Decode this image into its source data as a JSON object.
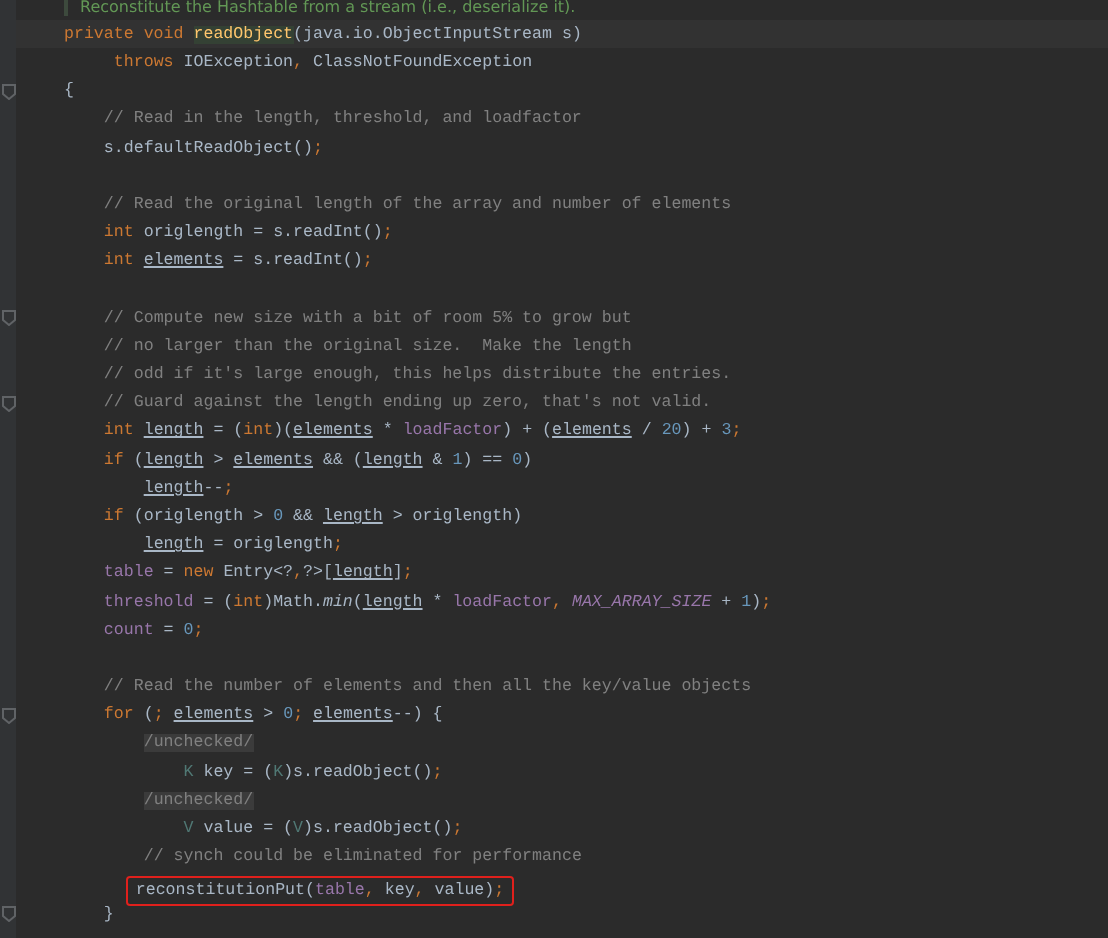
{
  "doc_comment": "Reconstitute the Hashtable from a stream (i.e., deserialize it).",
  "lines": [
    {
      "kind": "code",
      "current": true,
      "tokens": [
        {
          "t": "private void ",
          "kind": "kw"
        },
        {
          "t": "readObject",
          "kind": "decl"
        },
        {
          "t": "(java.io.ObjectInputStream s)",
          "kind": "plain"
        }
      ]
    },
    {
      "kind": "code",
      "tokens": [
        {
          "t": "     throws ",
          "kind": "kw"
        },
        {
          "t": "IOException",
          "kind": "plain"
        },
        {
          "t": ",",
          "kind": "kw"
        },
        {
          "t": " ClassNotFoundException",
          "kind": "plain"
        }
      ]
    },
    {
      "kind": "code",
      "fold": true,
      "tokens": [
        {
          "t": "{",
          "kind": "plain"
        }
      ]
    },
    {
      "kind": "code",
      "tokens": [
        {
          "t": "    // Read in the length, threshold, and loadfactor",
          "kind": "comment"
        }
      ]
    },
    {
      "kind": "code",
      "tokens": [
        {
          "t": "    s.defaultReadObject()",
          "kind": "plain"
        },
        {
          "t": ";",
          "kind": "kw"
        }
      ]
    },
    {
      "kind": "blank"
    },
    {
      "kind": "code",
      "tokens": [
        {
          "t": "    // Read the original length of the array and number of elements",
          "kind": "comment"
        }
      ]
    },
    {
      "kind": "code",
      "tokens": [
        {
          "t": "    int ",
          "kind": "kw"
        },
        {
          "t": "origlength = s.readInt()",
          "kind": "plain"
        },
        {
          "t": ";",
          "kind": "kw"
        }
      ]
    },
    {
      "kind": "code",
      "tokens": [
        {
          "t": "    int ",
          "kind": "kw"
        },
        {
          "t": "elements",
          "kind": "var"
        },
        {
          "t": " = s.readInt()",
          "kind": "plain"
        },
        {
          "t": ";",
          "kind": "kw"
        }
      ]
    },
    {
      "kind": "blank"
    },
    {
      "kind": "code",
      "fold": true,
      "tokens": [
        {
          "t": "    // Compute new size with a bit of room 5% to grow but",
          "kind": "comment"
        }
      ]
    },
    {
      "kind": "code",
      "tokens": [
        {
          "t": "    // no larger than the original size.  Make the length",
          "kind": "comment"
        }
      ]
    },
    {
      "kind": "code",
      "tokens": [
        {
          "t": "    // odd if it's large enough, this helps distribute the entries.",
          "kind": "comment"
        }
      ]
    },
    {
      "kind": "code",
      "fold": true,
      "tokens": [
        {
          "t": "    // Guard against the length ending up zero, that's not valid.",
          "kind": "comment"
        }
      ]
    },
    {
      "kind": "code",
      "tokens": [
        {
          "t": "    int ",
          "kind": "kw"
        },
        {
          "t": "length",
          "kind": "var"
        },
        {
          "t": " = (",
          "kind": "plain"
        },
        {
          "t": "int",
          "kind": "kw"
        },
        {
          "t": ")(",
          "kind": "plain"
        },
        {
          "t": "elements",
          "kind": "var"
        },
        {
          "t": " * ",
          "kind": "plain"
        },
        {
          "t": "loadFactor",
          "kind": "field"
        },
        {
          "t": ") + (",
          "kind": "plain"
        },
        {
          "t": "elements",
          "kind": "var"
        },
        {
          "t": " / ",
          "kind": "plain"
        },
        {
          "t": "20",
          "kind": "num"
        },
        {
          "t": ") + ",
          "kind": "plain"
        },
        {
          "t": "3",
          "kind": "num"
        },
        {
          "t": ";",
          "kind": "kw"
        }
      ]
    },
    {
      "kind": "code",
      "tokens": [
        {
          "t": "    if ",
          "kind": "kw"
        },
        {
          "t": "(",
          "kind": "plain"
        },
        {
          "t": "length",
          "kind": "var"
        },
        {
          "t": " > ",
          "kind": "plain"
        },
        {
          "t": "elements",
          "kind": "var"
        },
        {
          "t": " && (",
          "kind": "plain"
        },
        {
          "t": "length",
          "kind": "var"
        },
        {
          "t": " & ",
          "kind": "plain"
        },
        {
          "t": "1",
          "kind": "num"
        },
        {
          "t": ") == ",
          "kind": "plain"
        },
        {
          "t": "0",
          "kind": "num"
        },
        {
          "t": ")",
          "kind": "plain"
        }
      ]
    },
    {
      "kind": "code",
      "tokens": [
        {
          "t": "        length",
          "kind": "var"
        },
        {
          "t": "--",
          "kind": "plain"
        },
        {
          "t": ";",
          "kind": "kw"
        }
      ]
    },
    {
      "kind": "code",
      "tokens": [
        {
          "t": "    if ",
          "kind": "kw"
        },
        {
          "t": "(origlength > ",
          "kind": "plain"
        },
        {
          "t": "0",
          "kind": "num"
        },
        {
          "t": " && ",
          "kind": "plain"
        },
        {
          "t": "length",
          "kind": "var"
        },
        {
          "t": " > origlength)",
          "kind": "plain"
        }
      ]
    },
    {
      "kind": "code",
      "tokens": [
        {
          "t": "        length",
          "kind": "var"
        },
        {
          "t": " = origlength",
          "kind": "plain"
        },
        {
          "t": ";",
          "kind": "kw"
        }
      ]
    },
    {
      "kind": "code",
      "tokens": [
        {
          "t": "    table",
          "kind": "field"
        },
        {
          "t": " = ",
          "kind": "plain"
        },
        {
          "t": "new ",
          "kind": "kw"
        },
        {
          "t": "Entry<?",
          "kind": "plain"
        },
        {
          "t": ",",
          "kind": "kw"
        },
        {
          "t": "?>[",
          "kind": "plain"
        },
        {
          "t": "length",
          "kind": "var"
        },
        {
          "t": "]",
          "kind": "plain"
        },
        {
          "t": ";",
          "kind": "kw"
        }
      ]
    },
    {
      "kind": "code",
      "tokens": [
        {
          "t": "    threshold",
          "kind": "field"
        },
        {
          "t": " = (",
          "kind": "plain"
        },
        {
          "t": "int",
          "kind": "kw"
        },
        {
          "t": ")Math.",
          "kind": "plain"
        },
        {
          "t": "min",
          "kind": "static"
        },
        {
          "t": "(",
          "kind": "plain"
        },
        {
          "t": "length",
          "kind": "var"
        },
        {
          "t": " * ",
          "kind": "plain"
        },
        {
          "t": "loadFactor",
          "kind": "field"
        },
        {
          "t": ", ",
          "kind": "kw"
        },
        {
          "t": "MAX_ARRAY_SIZE",
          "kind": "const"
        },
        {
          "t": " + ",
          "kind": "plain"
        },
        {
          "t": "1",
          "kind": "num"
        },
        {
          "t": ")",
          "kind": "plain"
        },
        {
          "t": ";",
          "kind": "kw"
        }
      ]
    },
    {
      "kind": "code",
      "tokens": [
        {
          "t": "    count",
          "kind": "field"
        },
        {
          "t": " = ",
          "kind": "plain"
        },
        {
          "t": "0",
          "kind": "num"
        },
        {
          "t": ";",
          "kind": "kw"
        }
      ]
    },
    {
      "kind": "blank"
    },
    {
      "kind": "code",
      "tokens": [
        {
          "t": "    // Read the number of elements and then all the key/value objects",
          "kind": "comment"
        }
      ]
    },
    {
      "kind": "code",
      "fold": true,
      "tokens": [
        {
          "t": "    for ",
          "kind": "kw"
        },
        {
          "t": "(",
          "kind": "plain"
        },
        {
          "t": "; ",
          "kind": "kw"
        },
        {
          "t": "elements",
          "kind": "var"
        },
        {
          "t": " > ",
          "kind": "plain"
        },
        {
          "t": "0",
          "kind": "num"
        },
        {
          "t": "; ",
          "kind": "kw"
        },
        {
          "t": "elements",
          "kind": "var"
        },
        {
          "t": "--) {",
          "kind": "plain"
        }
      ]
    },
    {
      "kind": "code",
      "tokens": [
        {
          "t": "        /unchecked/",
          "kind": "suppress"
        }
      ]
    },
    {
      "kind": "code",
      "tokens": [
        {
          "t": "            K",
          "kind": "typeparam"
        },
        {
          "t": " key = (",
          "kind": "plain"
        },
        {
          "t": "K",
          "kind": "typeparam"
        },
        {
          "t": ")s.readObject()",
          "kind": "plain"
        },
        {
          "t": ";",
          "kind": "kw"
        }
      ]
    },
    {
      "kind": "code",
      "tokens": [
        {
          "t": "        /unchecked/",
          "kind": "suppress"
        }
      ]
    },
    {
      "kind": "code",
      "tokens": [
        {
          "t": "            V",
          "kind": "typeparam"
        },
        {
          "t": " value = (",
          "kind": "plain"
        },
        {
          "t": "V",
          "kind": "typeparam"
        },
        {
          "t": ")s.readObject()",
          "kind": "plain"
        },
        {
          "t": ";",
          "kind": "kw"
        }
      ]
    },
    {
      "kind": "code",
      "tokens": [
        {
          "t": "        // synch could be eliminated for performance",
          "kind": "comment"
        }
      ]
    },
    {
      "kind": "code",
      "highlighted": true,
      "tokens": [
        {
          "t": "       reconstitutionPut(",
          "kind": "plain"
        },
        {
          "t": "table",
          "kind": "field"
        },
        {
          "t": ", ",
          "kind": "kw"
        },
        {
          "t": "key",
          "kind": "plain"
        },
        {
          "t": ", ",
          "kind": "kw"
        },
        {
          "t": "value)",
          "kind": "plain"
        },
        {
          "t": ";",
          "kind": "kw"
        }
      ]
    },
    {
      "kind": "code",
      "fold": true,
      "tokens": [
        {
          "t": "    }",
          "kind": "plain"
        }
      ]
    }
  ]
}
